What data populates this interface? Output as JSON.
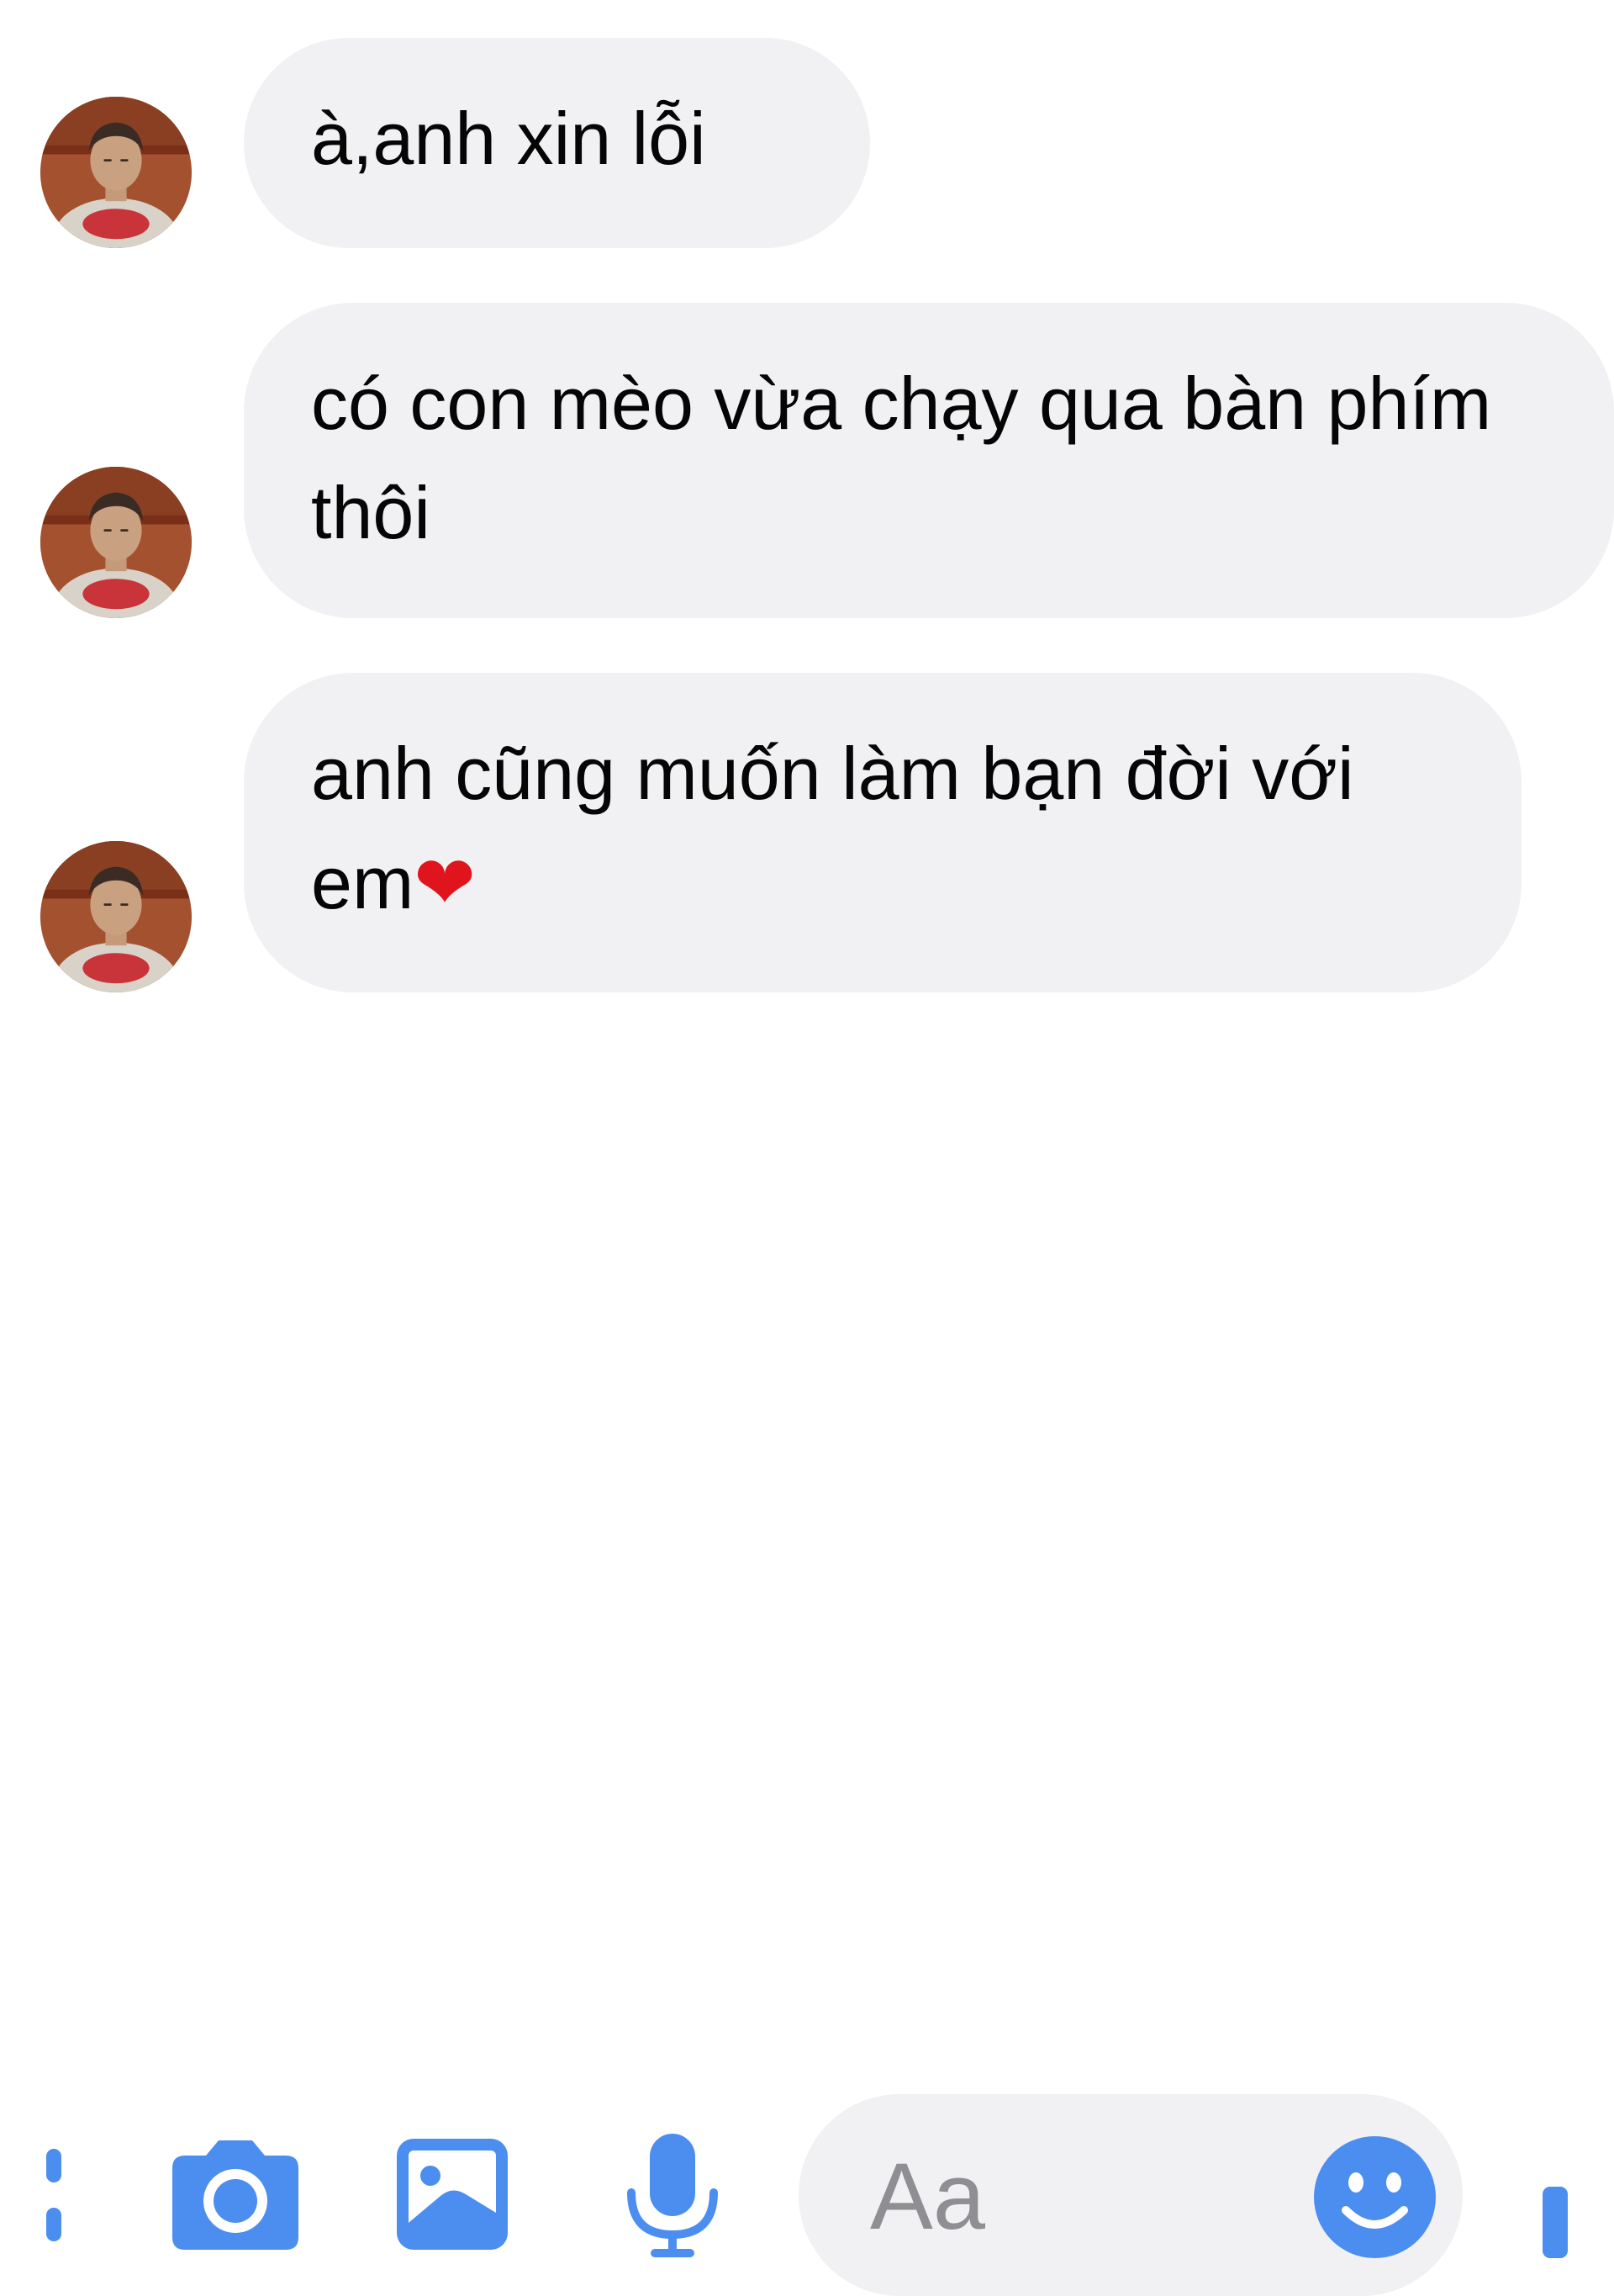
{
  "messages": [
    {
      "text": "à,anh xin lỗi",
      "heart": ""
    },
    {
      "text": "có con mèo vừa chạy qua bàn phím thôi",
      "heart": ""
    },
    {
      "text": "anh cũng muốn làm bạn đời với em",
      "heart": "❤"
    }
  ],
  "composer": {
    "placeholder": "Aa",
    "icons": [
      "more-icon",
      "camera-icon",
      "image-icon",
      "microphone-icon",
      "emoji-icon",
      "send-icon"
    ]
  },
  "colors": {
    "accent": "#4b8ef0",
    "bubble": "#f1f1f3",
    "placeholder": "#8e8e93",
    "heart": "#e0141d"
  }
}
